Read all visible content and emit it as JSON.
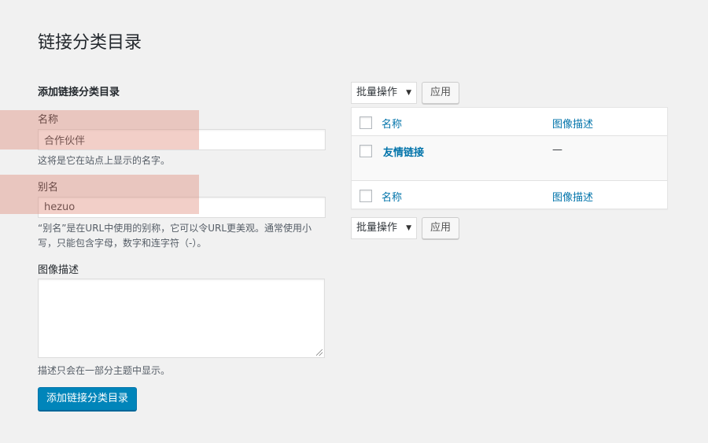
{
  "page": {
    "title": "链接分类目录"
  },
  "form": {
    "heading": "添加链接分类目录",
    "name": {
      "label": "名称",
      "value": "合作伙伴",
      "help": "这将是它在站点上显示的名字。"
    },
    "slug": {
      "label": "别名",
      "value": "hezuo",
      "help": "“别名”是在URL中使用的别称，它可以令URL更美观。通常使用小写，只能包含字母，数字和连字符（-）。"
    },
    "description": {
      "label": "图像描述",
      "value": "",
      "help": "描述只会在一部分主题中显示。"
    },
    "submit_label": "添加链接分类目录"
  },
  "list": {
    "bulk_action": {
      "selected": "批量操作",
      "apply_label": "应用"
    },
    "columns": {
      "name": "名称",
      "description": "图像描述"
    },
    "rows": [
      {
        "name": "友情链接",
        "description": "—"
      }
    ]
  },
  "colors": {
    "accent": "#0073aa",
    "primary_button": "#0085ba",
    "highlight": "#de826e"
  }
}
